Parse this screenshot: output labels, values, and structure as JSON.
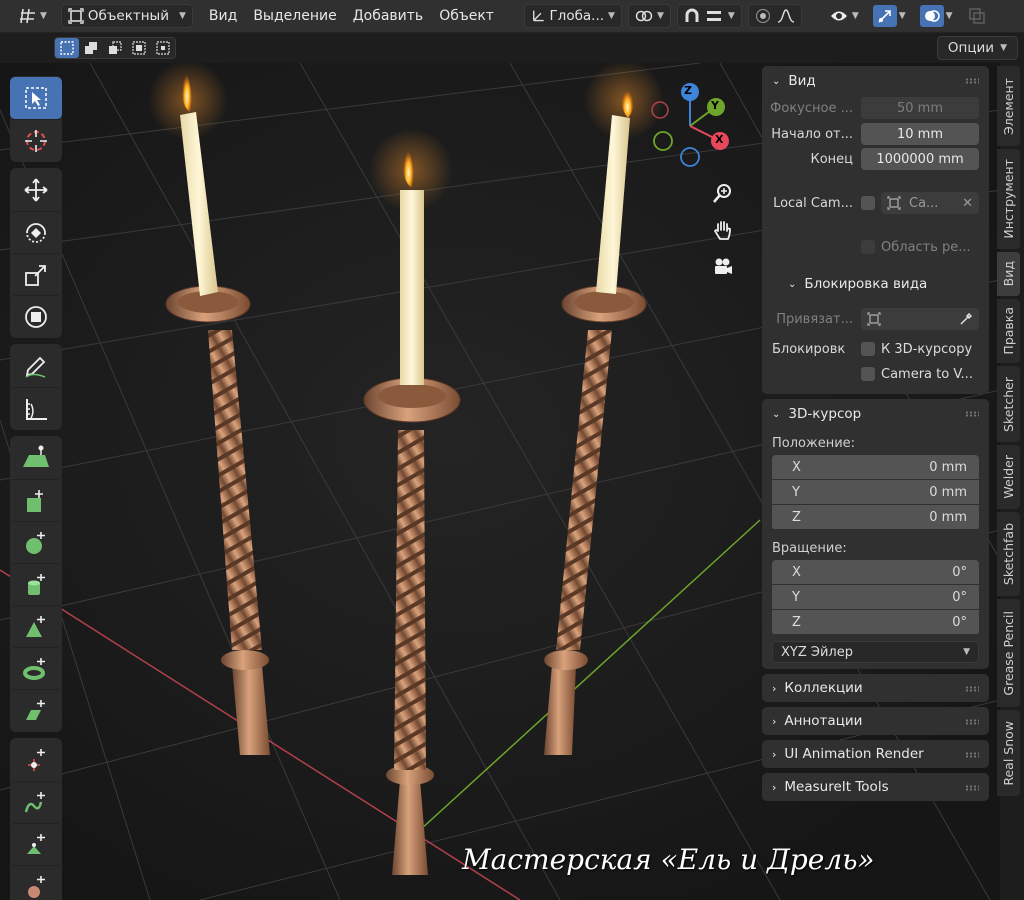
{
  "header": {
    "mode_label": "Объектный",
    "menus": [
      "Вид",
      "Выделение",
      "Добавить",
      "Объект"
    ],
    "orientation_label": "Глоба...",
    "options_label": "Опции"
  },
  "sidebar": {
    "view_panel": {
      "title": "Вид",
      "focal_label": "Фокусное ...",
      "focal_value": "50 mm",
      "clip_start_label": "Начало от...",
      "clip_start_value": "10 mm",
      "clip_end_label": "Конец",
      "clip_end_value": "1000000 mm",
      "local_camera_label": "Local Cam...",
      "local_camera_value": "Ca...",
      "render_region_label": "Область ре...",
      "lock_subtitle": "Блокировка вида",
      "lock_object_label": "Привязат...",
      "lock_label": "Блокировк",
      "lock_cursor_label": "К 3D-курсору",
      "camera_to_view_label": "Camera to V..."
    },
    "cursor_panel": {
      "title": "3D-курсор",
      "location_label": "Положение:",
      "location": [
        {
          "axis": "X",
          "value": "0 mm"
        },
        {
          "axis": "Y",
          "value": "0 mm"
        },
        {
          "axis": "Z",
          "value": "0 mm"
        }
      ],
      "rotation_label": "Вращение:",
      "rotation": [
        {
          "axis": "X",
          "value": "0°"
        },
        {
          "axis": "Y",
          "value": "0°"
        },
        {
          "axis": "Z",
          "value": "0°"
        }
      ],
      "rotation_mode": "XYZ Эйлер"
    },
    "collapsed_panels": [
      "Коллекции",
      "Аннотации",
      "UI Animation Render",
      "MeasureIt Tools"
    ]
  },
  "tabs": [
    "Элемент",
    "Инструмент",
    "Вид",
    "Правка",
    "Sketcher",
    "Welder",
    "Sketchfab",
    "Grease Pencil",
    "Real Snow"
  ],
  "gizmo": {
    "x": "X",
    "y": "Y",
    "z": "Z"
  },
  "watermark": "Мастерская «Ель и Дрель»",
  "colors": {
    "accent": "#4772b3",
    "x_axis": "#e8485a",
    "y_axis": "#6fa52a",
    "z_axis": "#3f84d9"
  }
}
